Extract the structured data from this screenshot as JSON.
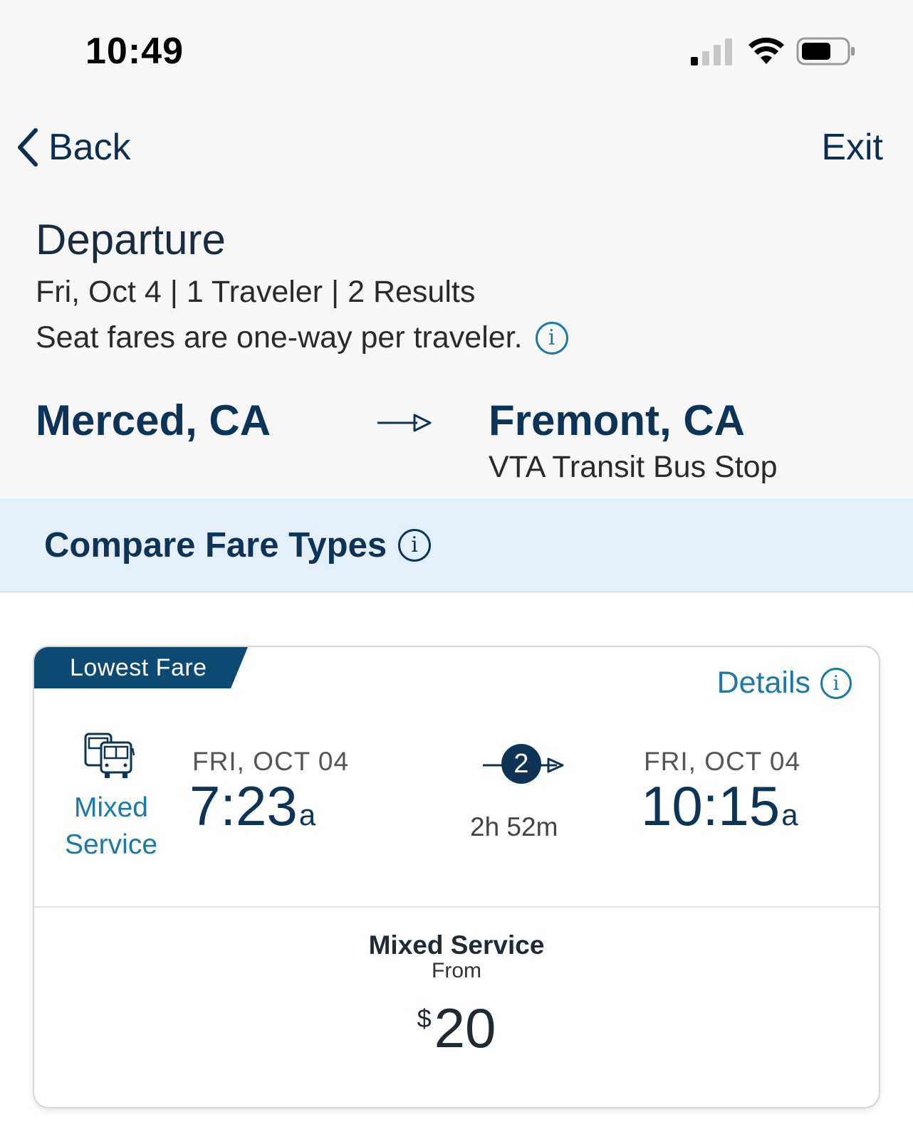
{
  "status_bar": {
    "time": "10:49"
  },
  "nav": {
    "back_label": "Back",
    "exit_label": "Exit"
  },
  "header": {
    "title": "Departure",
    "summary": "Fri, Oct 4 | 1 Traveler | 2 Results",
    "fare_note": "Seat fares are one-way per traveler."
  },
  "route": {
    "origin": "Merced, CA",
    "destination": "Fremont, CA",
    "destination_stop": "VTA Transit Bus Stop"
  },
  "compare": {
    "label": "Compare Fare Types"
  },
  "results": [
    {
      "badge": "Lowest Fare",
      "details_label": "Details",
      "service": "Mixed Service",
      "service_line1": "Mixed",
      "service_line2": "Service",
      "departure_date": "FRI, OCT 04",
      "departure_time": "7:23",
      "departure_ampm": "a",
      "stops": "2",
      "duration": "2h 52m",
      "arrival_date": "FRI, OCT 04",
      "arrival_time": "10:15",
      "arrival_ampm": "a",
      "fare_type": "Mixed Service",
      "fare_from_label": "From",
      "currency": "$",
      "price": "20"
    }
  ],
  "icons": [
    "chevron-left-icon",
    "info-icon",
    "arrow-right-icon",
    "bus-icon",
    "signal-icon",
    "wifi-icon",
    "battery-icon"
  ],
  "colors": {
    "navy": "#0d3457",
    "link_blue": "#1b79a8",
    "badge": "#0d4a73",
    "band": "#e4f0f9"
  }
}
